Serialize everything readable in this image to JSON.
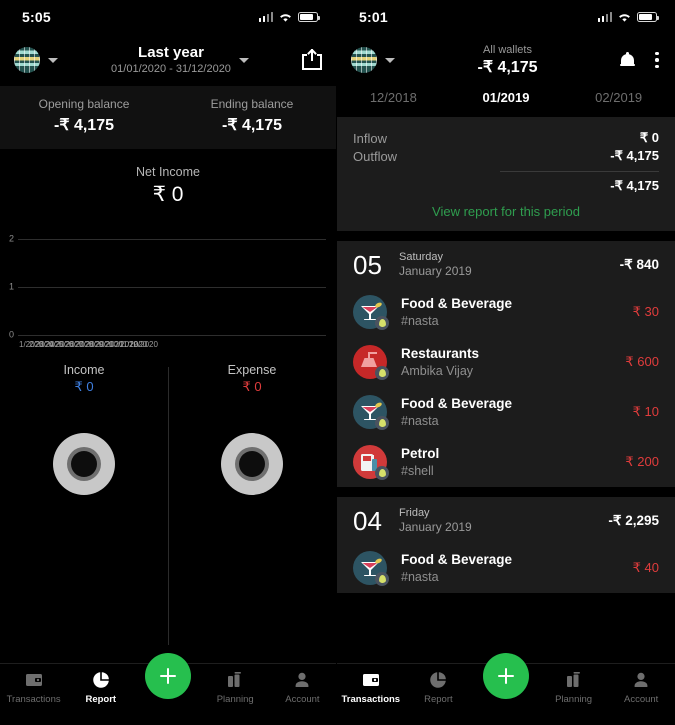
{
  "left": {
    "statusbar": {
      "time": "5:05",
      "signal_icon": "signal-bars-icon",
      "wifi_icon": "wifi-icon",
      "battery_icon": "battery-icon"
    },
    "appbar": {
      "wallet_icon": "globe-wallet-icon",
      "wallet_caret": "chevron-down-icon",
      "period_title": "Last year",
      "period_range": "01/01/2020 - 31/12/2020",
      "period_caret": "chevron-down-icon",
      "export_icon": "export-share-icon"
    },
    "balances": [
      {
        "label": "Opening balance",
        "value": "-₹ 4,175"
      },
      {
        "label": "Ending balance",
        "value": "-₹ 4,175"
      }
    ],
    "net_income": {
      "label": "Net Income",
      "value": "₹ 0"
    },
    "totals": [
      {
        "label": "Income",
        "value": "₹ 0",
        "color": "#3f7fe0"
      },
      {
        "label": "Expense",
        "value": "₹ 0",
        "color": "#e03c3c"
      }
    ],
    "nav": {
      "items": [
        {
          "label": "Transactions",
          "icon": "wallet-icon",
          "active": false
        },
        {
          "label": "Report",
          "icon": "pie-chart-icon",
          "active": true
        },
        {
          "label": "Planning",
          "icon": "books-icon",
          "active": false
        },
        {
          "label": "Account",
          "icon": "person-icon",
          "active": false
        }
      ],
      "fab": {
        "icon": "plus-icon",
        "color": "#26bf4e"
      }
    }
  },
  "chart_data": {
    "type": "line",
    "title": "Net Income",
    "subtitle": "₹ 0",
    "xlabel": "",
    "ylabel": "",
    "ylim": [
      0,
      2
    ],
    "yticks": [
      "0",
      "1",
      "2"
    ],
    "grid": true,
    "legend": "none",
    "x": [
      "01/2020",
      "02/2020",
      "03/2020",
      "04/2020",
      "05/2020",
      "06/2020",
      "07/2020",
      "08/2020",
      "09/2020",
      "10/2020",
      "11/2020",
      "12/2020"
    ],
    "xtick_labels": [
      "1/2020",
      "2/2020",
      "3/2020",
      "4/2020",
      "5/2020",
      "6/2020",
      "7/2020",
      "8/2020",
      "9/2020",
      "10/2020",
      "11/2020",
      "12/2020"
    ],
    "series": [
      {
        "name": "Net Income",
        "values": [
          0,
          0,
          0,
          0,
          0,
          0,
          0,
          0,
          0,
          0,
          0,
          0
        ]
      }
    ]
  },
  "right": {
    "statusbar": {
      "time": "5:01",
      "signal_icon": "signal-bars-icon",
      "wifi_icon": "wifi-icon",
      "battery_icon": "battery-icon"
    },
    "appbar": {
      "wallet_icon": "globe-wallet-icon",
      "wallet_caret": "chevron-down-icon",
      "wallet_label": "All wallets",
      "wallet_value": "-₹ 4,175",
      "bell_icon": "bell-icon",
      "overflow_icon": "more-vertical-icon"
    },
    "months": [
      {
        "label": "12/2018",
        "active": false
      },
      {
        "label": "01/2019",
        "active": true
      },
      {
        "label": "02/2019",
        "active": false
      }
    ],
    "flow": {
      "inflow_label": "Inflow",
      "inflow_value": "₹ 0",
      "outflow_label": "Outflow",
      "outflow_value": "-₹ 4,175",
      "total_value": "-₹ 4,175",
      "link": "View report for this period",
      "link_color": "#2f9e4f"
    },
    "groups": [
      {
        "day": "05",
        "dow": "Saturday",
        "month_year": "January 2019",
        "total": "-₹ 840",
        "txns": [
          {
            "title": "Food & Beverage",
            "sub": "#nasta",
            "amount": "₹ 30",
            "icon": "cocktail-icon"
          },
          {
            "title": "Restaurants",
            "sub": "Ambika Vijay",
            "amount": "₹ 600",
            "icon": "restaurant-lamp-icon"
          },
          {
            "title": "Food & Beverage",
            "sub": "#nasta",
            "amount": "₹ 10",
            "icon": "cocktail-icon"
          },
          {
            "title": "Petrol",
            "sub": "#shell",
            "amount": "₹ 200",
            "icon": "fuel-pump-icon"
          }
        ]
      },
      {
        "day": "04",
        "dow": "Friday",
        "month_year": "January 2019",
        "total": "-₹ 2,295",
        "txns": [
          {
            "title": "Food & Beverage",
            "sub": "#nasta",
            "amount": "₹ 40",
            "icon": "cocktail-icon"
          }
        ]
      }
    ],
    "nav": {
      "items": [
        {
          "label": "Transactions",
          "icon": "wallet-icon",
          "active": true
        },
        {
          "label": "Report",
          "icon": "pie-chart-icon",
          "active": false
        },
        {
          "label": "Planning",
          "icon": "books-icon",
          "active": false
        },
        {
          "label": "Account",
          "icon": "person-icon",
          "active": false
        }
      ],
      "fab": {
        "icon": "plus-icon",
        "color": "#26bf4e"
      }
    }
  }
}
